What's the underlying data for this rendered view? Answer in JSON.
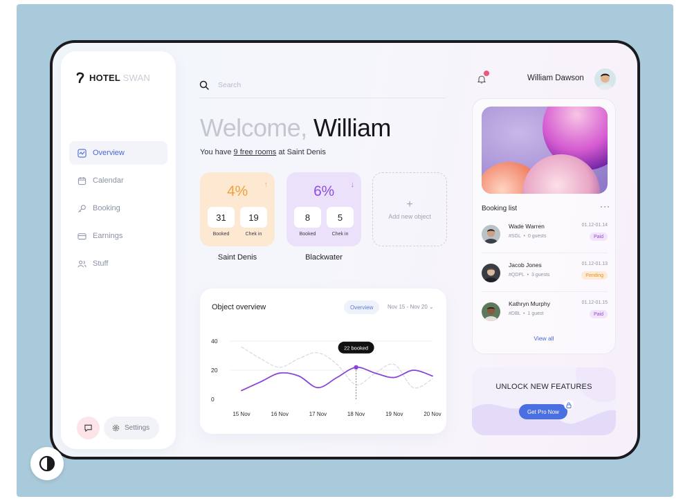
{
  "brand": {
    "name": "HOTEL",
    "name_light": "SWAN"
  },
  "nav": {
    "items": [
      {
        "label": "Overview",
        "icon": "chart-icon",
        "active": true
      },
      {
        "label": "Calendar",
        "icon": "calendar-icon",
        "active": false
      },
      {
        "label": "Booking",
        "icon": "key-icon",
        "active": false
      },
      {
        "label": "Earnings",
        "icon": "card-icon",
        "active": false
      },
      {
        "label": "Stuff",
        "icon": "users-icon",
        "active": false
      }
    ],
    "settings_label": "Settings"
  },
  "search": {
    "placeholder": "Search"
  },
  "user": {
    "name": "William Dawson"
  },
  "welcome": {
    "prefix": "Welcome,",
    "name": "William",
    "subtitle_pre": "You have",
    "subtitle_link": "9 free rooms",
    "subtitle_post": "at Saint Denis"
  },
  "hotels": [
    {
      "name": "Saint Denis",
      "percent": "4%",
      "trend": "↑",
      "booked": "31",
      "booked_label": "Booked",
      "checkin": "19",
      "checkin_label": "Chek in"
    },
    {
      "name": "Blackwater",
      "percent": "6%",
      "trend": "↓",
      "booked": "8",
      "booked_label": "Booked",
      "checkin": "5",
      "checkin_label": "Chek in"
    }
  ],
  "add_object": {
    "plus": "+",
    "label": "Add new object"
  },
  "overview": {
    "title": "Object overview",
    "tab": "Overview",
    "range": "Nov 15 - Nov 20 ⌄",
    "tooltip": "22 booked"
  },
  "chart_data": {
    "type": "line",
    "x": [
      "15 Nov",
      "16 Nov",
      "17 Nov",
      "18 Nov",
      "19 Nov",
      "20 Nov"
    ],
    "yticks": [
      0,
      20,
      40
    ],
    "ylim": [
      0,
      40
    ],
    "grid": true,
    "series": [
      {
        "style": "solid",
        "color": "#8a45d6",
        "x": [
          0,
          0.5,
          1,
          1.5,
          2,
          2.5,
          3,
          3.5,
          4,
          4.5,
          5
        ],
        "values": [
          6,
          12,
          18,
          16,
          8,
          15,
          22,
          18,
          15,
          20,
          16
        ]
      },
      {
        "style": "dashed",
        "color": "#d9dbe2",
        "x": [
          0,
          0.5,
          1,
          1.5,
          2,
          2.5,
          3,
          3.5,
          4,
          4.5,
          5
        ],
        "values": [
          36,
          28,
          22,
          28,
          32,
          24,
          10,
          18,
          24,
          8,
          14
        ]
      }
    ],
    "highlight": {
      "x": 3,
      "value": 22,
      "label": "22 booked"
    }
  },
  "bookings": {
    "title": "Booking list",
    "more": "···",
    "items": [
      {
        "name": "Wade Warren",
        "code": "#SGL",
        "guests": "0 guests",
        "dates": "01.12-01.14",
        "status": "Paid"
      },
      {
        "name": "Jacob Jones",
        "code": "#QDPL",
        "guests": "3 guests",
        "dates": "01.12-01.13",
        "status": "Pending"
      },
      {
        "name": "Kathryn Murphy",
        "code": "#DBL",
        "guests": "1 guest",
        "dates": "01.12-01.15",
        "status": "Paid"
      }
    ],
    "view_all": "View all"
  },
  "unlock": {
    "title": "UNLOCK NEW FEATURES",
    "button": "Get Pro Now"
  },
  "colors": {
    "accent": "#4a67d6",
    "purple": "#8a45d6",
    "orange": "#f0a23e",
    "pink": "#f0567c",
    "frame_bg": "#a9cadb"
  }
}
